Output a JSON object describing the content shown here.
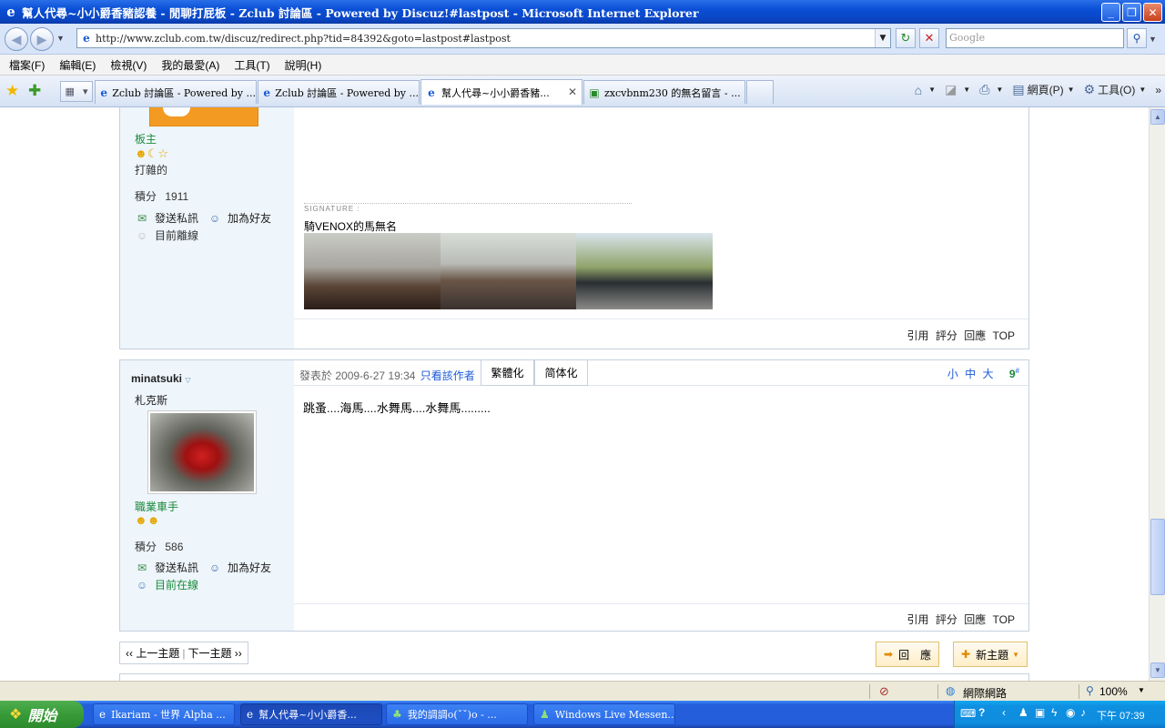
{
  "window": {
    "title": "幫人代尋~小小爵香豬認養 - 閒聊打屁板 - Zclub 討論區 - Powered by Discuz!#lastpost - Microsoft Internet Explorer"
  },
  "address": {
    "url": "http://www.zclub.com.tw/discuz/redirect.php?tid=84392&goto=lastpost#lastpost",
    "search_placeholder": "Google"
  },
  "menu": [
    "檔案(F)",
    "編輯(E)",
    "檢視(V)",
    "我的最愛(A)",
    "工具(T)",
    "說明(H)"
  ],
  "tabs": [
    {
      "label": "Zclub 討論區 - Powered by ..."
    },
    {
      "label": "Zclub 討論區 - Powered by ..."
    },
    {
      "label": "幫人代尋~小小爵香豬..."
    },
    {
      "label": "zxcvbnm230 的無名留言 - ..."
    }
  ],
  "commands": {
    "page": "網頁(P)",
    "tools": "工具(O)"
  },
  "post1": {
    "rank": "板主",
    "title": "打雜的",
    "points_label": "積分",
    "points": "1911",
    "send_pm": "發送私訊",
    "add_friend": "加為好友",
    "status": "目前離線",
    "signature_label": "SIGNATURE :",
    "signature_text": "騎VENOX的馬無名",
    "footer": [
      "引用",
      "評分",
      "回應",
      "TOP"
    ]
  },
  "post2": {
    "author": "minatsuki",
    "nickname": "札克斯",
    "rank": "職業車手",
    "points_label": "積分",
    "points": "586",
    "send_pm": "發送私訊",
    "add_friend": "加為好友",
    "status": "目前在線",
    "posted_prefix": "發表於",
    "posted_at": "2009-6-27 19:34",
    "only_author": "只看該作者",
    "traditional": "繁體化",
    "simplified": "简体化",
    "font_small": "小",
    "font_medium": "中",
    "font_large": "大",
    "floor": "9",
    "floor_mark": "#",
    "body": "跳蚤....海馬....水舞馬....水舞馬.........",
    "footer": [
      "引用",
      "評分",
      "回應",
      "TOP"
    ]
  },
  "pager": {
    "prev": "‹‹ 上一主題",
    "next": "下一主題 ››"
  },
  "buttons": {
    "reply": "回　應",
    "new_topic": "新主題"
  },
  "status": {
    "zone": "網際網路",
    "zoom": "100%"
  },
  "taskbar": {
    "start": "開始",
    "tasks": [
      {
        "label": "Ikariam - 世界 Alpha ..."
      },
      {
        "label": "幫人代尋~小小爵香..."
      },
      {
        "label": "我的調調o(ˇˇ)o - ..."
      },
      {
        "label": "Windows Live Messen..."
      }
    ],
    "clock": "下午 07:39"
  }
}
